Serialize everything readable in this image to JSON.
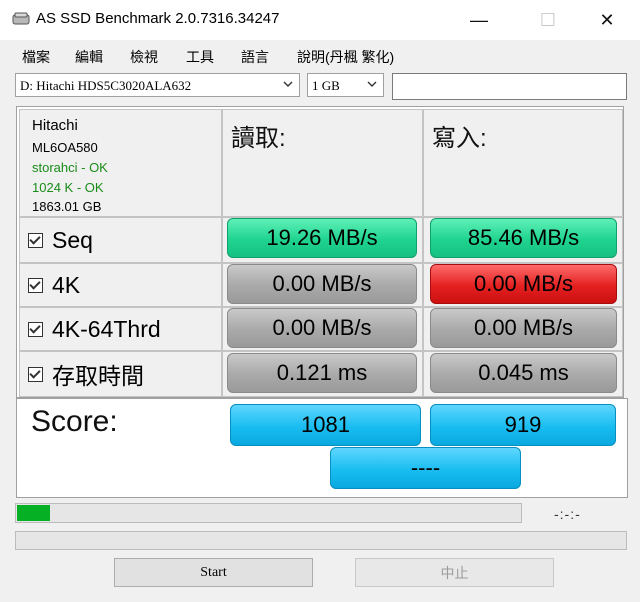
{
  "window": {
    "title": "AS SSD Benchmark 2.0.7316.34247",
    "min_glyph": "—",
    "max_glyph": "☐",
    "close_glyph": "✕"
  },
  "menu": [
    "檔案",
    "編輯",
    "檢視",
    "工具",
    "語言",
    "說明(丹楓 繁化)"
  ],
  "drive": {
    "selected": "D: Hitachi HDS5C3020ALA632"
  },
  "test_size": {
    "selected": "1 GB"
  },
  "status_field": "",
  "info": {
    "vendor": "Hitachi",
    "firmware": "ML6OA580",
    "driver": "storahci - OK",
    "alignment": "1024 K - OK",
    "capacity": "1863.01 GB"
  },
  "headers": {
    "read": "讀取:",
    "write": "寫入:"
  },
  "rows": [
    {
      "label": "Seq",
      "read": "19.26 MB/s",
      "write": "85.46 MB/s"
    },
    {
      "label": "4K",
      "read": "0.00 MB/s",
      "write": "0.00 MB/s"
    },
    {
      "label": "4K-64Thrd",
      "read": "0.00 MB/s",
      "write": "0.00 MB/s"
    },
    {
      "label": "存取時間",
      "read": "0.121 ms",
      "write": "0.045 ms"
    }
  ],
  "score": {
    "label": "Score:",
    "read": "1081",
    "write": "919",
    "total": "----"
  },
  "progress": {
    "fraction": 0.065,
    "time": "-:-:-"
  },
  "buttons": {
    "start": "Start",
    "stop": "中止"
  },
  "colors": {
    "green": "#1fd48f",
    "gray": "#a9a9a9",
    "red": "#e42020",
    "blue": "#19bdf0",
    "progress": "#06b025"
  },
  "icons": {
    "app": "hard-drive-icon",
    "dropdown": "chevron-down-icon",
    "checkbox": "checkbox-checked-icon"
  }
}
